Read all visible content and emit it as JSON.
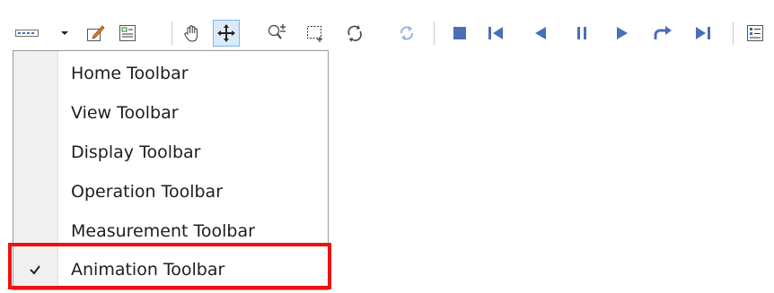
{
  "toolbar": {
    "buttons": [
      {
        "name": "toolbars-dropdown-button",
        "icon": "toolbar-strip-icon"
      },
      {
        "name": "toolbars-dropdown-arrow",
        "icon": "chevron-down-icon"
      },
      {
        "name": "edit-button",
        "icon": "edit-icon"
      },
      {
        "name": "properties-button",
        "icon": "properties-icon"
      },
      {
        "name": "pan-button",
        "icon": "hand-icon"
      },
      {
        "name": "move-button",
        "icon": "move-icon"
      },
      {
        "name": "zoom-in-button",
        "icon": "zoom-in-icon"
      },
      {
        "name": "zoom-window-button",
        "icon": "zoom-window-icon"
      },
      {
        "name": "rotate-button",
        "icon": "rotate-icon"
      },
      {
        "name": "refresh-button",
        "icon": "refresh-icon"
      },
      {
        "name": "stop-button",
        "icon": "stop-icon"
      },
      {
        "name": "first-frame-button",
        "icon": "skip-back-icon"
      },
      {
        "name": "previous-frame-button",
        "icon": "step-back-icon"
      },
      {
        "name": "pause-button",
        "icon": "pause-icon"
      },
      {
        "name": "play-button",
        "icon": "play-icon"
      },
      {
        "name": "redo-button",
        "icon": "redo-icon"
      },
      {
        "name": "last-frame-button",
        "icon": "skip-forward-icon"
      },
      {
        "name": "settings-list-button",
        "icon": "list-icon"
      }
    ],
    "accent_color": "#4a6fb5"
  },
  "menu": {
    "items": [
      {
        "label": "Home Toolbar",
        "checked": false
      },
      {
        "label": "View Toolbar",
        "checked": false
      },
      {
        "label": "Display Toolbar",
        "checked": false
      },
      {
        "label": "Operation Toolbar",
        "checked": false
      },
      {
        "label": "Measurement Toolbar",
        "checked": false
      },
      {
        "label": "Animation Toolbar",
        "checked": true
      }
    ],
    "highlight_color": "#ee1111"
  }
}
